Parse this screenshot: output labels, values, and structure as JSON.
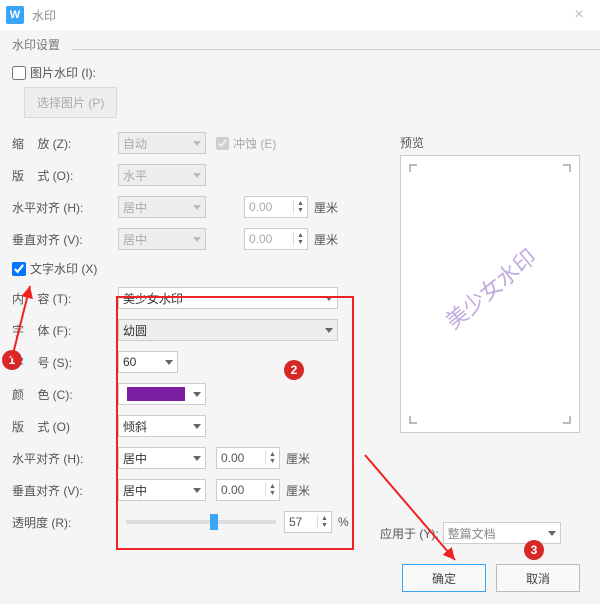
{
  "titlebar": {
    "title": "水印"
  },
  "group": {
    "label": "水印设置"
  },
  "image_watermark": {
    "checkbox_label": "图片水印 (I):",
    "pick_button": "选择图片 (P)",
    "zoom_label": "缩    放 (Z):",
    "zoom_value": "自动",
    "erode_label": "冲蚀 (E)",
    "layout_label": "版    式 (O):",
    "layout_value": "水平",
    "halign_label": "水平对齐 (H):",
    "halign_value": "居中",
    "halign_num": "0.00",
    "valign_label": "垂直对齐 (V):",
    "valign_value": "居中",
    "valign_num": "0.00",
    "unit": "厘米"
  },
  "text_watermark": {
    "checkbox_label": "文字水印 (X)",
    "content_label": "内    容 (T):",
    "content_value": "美少女水印",
    "font_label": "字    体 (F):",
    "font_value": "幼圆",
    "size_label": "字    号 (S):",
    "size_value": "60",
    "color_label": "颜    色 (C):",
    "layout_label": "版    式 (O)",
    "layout_value": "倾斜",
    "halign_label": "水平对齐 (H):",
    "halign_value": "居中",
    "halign_num": "0.00",
    "valign_label": "垂直对齐 (V):",
    "valign_value": "居中",
    "valign_num": "0.00",
    "unit": "厘米",
    "opacity_label": "透明度 (R):",
    "opacity_value": "57",
    "opacity_pct": "%"
  },
  "preview": {
    "label": "预览",
    "sample_text": "美少女水印"
  },
  "apply": {
    "label": "应用于 (Y):",
    "value": "整篇文档"
  },
  "buttons": {
    "ok": "确定",
    "cancel": "取消"
  },
  "badges": {
    "b1": "1",
    "b2": "2",
    "b3": "3"
  },
  "colors": {
    "accent": "#3aa4f5",
    "swatch": "#7c1ea1",
    "red": "#e22"
  }
}
